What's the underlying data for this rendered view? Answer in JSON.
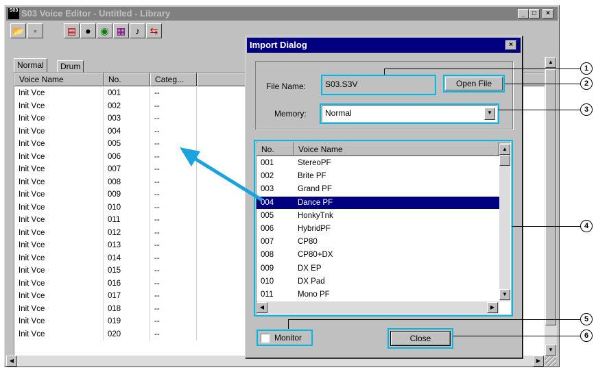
{
  "main_window": {
    "title": "S03 Voice Editor - Untitled - Library",
    "app_icon_text": "S03",
    "tabs": [
      {
        "label": "Normal"
      },
      {
        "label": "Drum"
      }
    ],
    "columns": [
      "Voice Name",
      "No.",
      "Categ..."
    ],
    "rows": [
      {
        "name": "Init Vce",
        "no": "001",
        "cat": "--"
      },
      {
        "name": "Init Vce",
        "no": "002",
        "cat": "--"
      },
      {
        "name": "Init Vce",
        "no": "003",
        "cat": "--"
      },
      {
        "name": "Init Vce",
        "no": "004",
        "cat": "--"
      },
      {
        "name": "Init Vce",
        "no": "005",
        "cat": "--"
      },
      {
        "name": "Init Vce",
        "no": "006",
        "cat": "--"
      },
      {
        "name": "Init Vce",
        "no": "007",
        "cat": "--"
      },
      {
        "name": "Init Vce",
        "no": "008",
        "cat": "--"
      },
      {
        "name": "Init Vce",
        "no": "009",
        "cat": "--"
      },
      {
        "name": "Init Vce",
        "no": "010",
        "cat": "--"
      },
      {
        "name": "Init Vce",
        "no": "011",
        "cat": "--"
      },
      {
        "name": "Init Vce",
        "no": "012",
        "cat": "--"
      },
      {
        "name": "Init Vce",
        "no": "013",
        "cat": "--"
      },
      {
        "name": "Init Vce",
        "no": "014",
        "cat": "--"
      },
      {
        "name": "Init Vce",
        "no": "015",
        "cat": "--"
      },
      {
        "name": "Init Vce",
        "no": "016",
        "cat": "--"
      },
      {
        "name": "Init Vce",
        "no": "017",
        "cat": "--"
      },
      {
        "name": "Init Vce",
        "no": "018",
        "cat": "--"
      },
      {
        "name": "Init Vce",
        "no": "019",
        "cat": "--"
      },
      {
        "name": "Init Vce",
        "no": "020",
        "cat": "--"
      }
    ],
    "toolbar_icons": [
      "open-folder-icon",
      "save-disk-icon",
      "edit-voice-icon",
      "play-icon",
      "globe-icon",
      "keyboard-icon",
      "midi-icon",
      "transfer-icon"
    ]
  },
  "dialog": {
    "title": "Import Dialog",
    "file_name_label": "File Name:",
    "file_name_value": "S03.S3V",
    "open_file_label": "Open File",
    "memory_label": "Memory:",
    "memory_value": "Normal",
    "columns": [
      "No.",
      "Voice Name"
    ],
    "rows": [
      {
        "no": "001",
        "name": "StereoPF"
      },
      {
        "no": "002",
        "name": "Brite PF"
      },
      {
        "no": "003",
        "name": "Grand PF"
      },
      {
        "no": "004",
        "name": "Dance PF"
      },
      {
        "no": "005",
        "name": "HonkyTnk"
      },
      {
        "no": "006",
        "name": "HybridPF"
      },
      {
        "no": "007",
        "name": "CP80"
      },
      {
        "no": "008",
        "name": "CP80+DX"
      },
      {
        "no": "009",
        "name": "DX EP"
      },
      {
        "no": "010",
        "name": "DX Pad"
      },
      {
        "no": "011",
        "name": "Mono PF"
      }
    ],
    "selected_row": 3,
    "monitor_label": "Monitor",
    "close_label": "Close"
  },
  "callouts": [
    "1",
    "2",
    "3",
    "4",
    "5",
    "6"
  ],
  "colors": {
    "highlight": "#00b7e6",
    "arrow": "#1aa3dc",
    "active_title": "#000080",
    "inactive_title": "#808080"
  }
}
